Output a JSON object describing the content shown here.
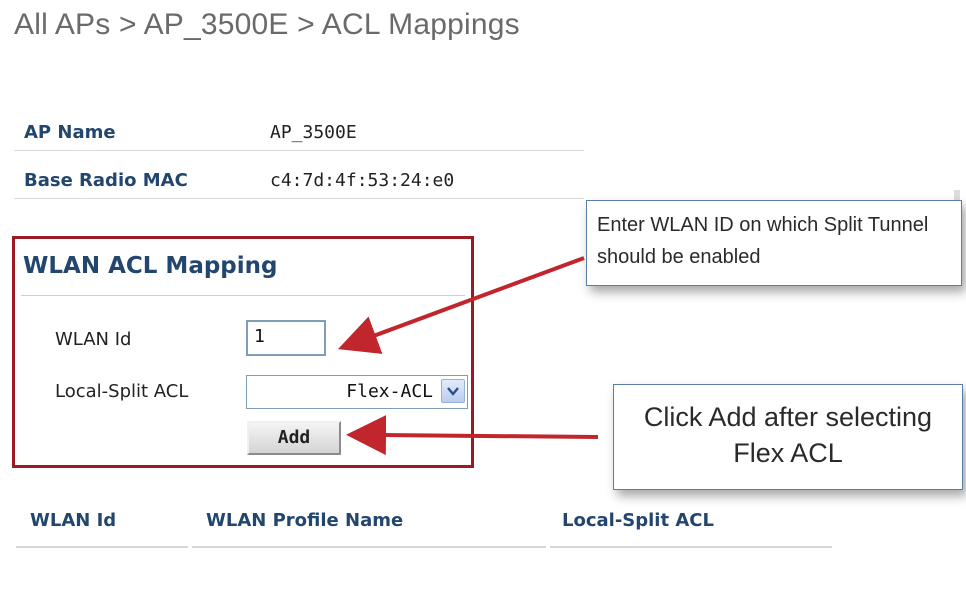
{
  "breadcrumb": {
    "text": "All APs > AP_3500E > ACL Mappings"
  },
  "ap_info": {
    "rows": [
      {
        "label": "AP Name",
        "value": "AP_3500E"
      },
      {
        "label": "Base Radio MAC",
        "value": "c4:7d:4f:53:24:e0"
      }
    ]
  },
  "wlan_acl_mapping": {
    "title": "WLAN ACL Mapping",
    "wlan_id_label": "WLAN Id",
    "wlan_id_value": "1",
    "local_split_acl_label": "Local-Split ACL",
    "local_split_acl_selected": "Flex-ACL",
    "add_label": "Add"
  },
  "callouts": {
    "wlan_hint": "Enter WLAN ID on which Split Tunnel should be enabled",
    "add_hint": "Click Add after selecting Flex ACL"
  },
  "table": {
    "columns": [
      "WLAN Id",
      "WLAN Profile Name",
      "Local-Split ACL"
    ]
  },
  "colors": {
    "highlight_border": "#9b1b24",
    "arrow": "#c0262c",
    "label_blue": "#22466e"
  },
  "icons": {
    "select_arrow": "chevron-down-icon"
  }
}
